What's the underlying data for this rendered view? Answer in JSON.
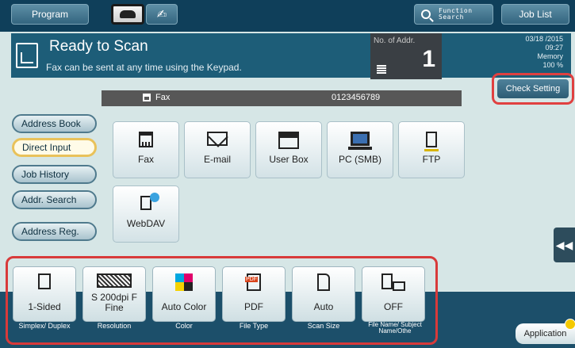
{
  "topbar": {
    "program": "Program",
    "function_search_1": "Function",
    "function_search_2": "Search",
    "job_list": "Job List"
  },
  "status": {
    "title": "Ready to Scan",
    "subtitle": "Fax can be sent at any time using the Keypad.",
    "addr_label": "No. of Addr.",
    "addr_count": "1",
    "date": "03/18 /2015",
    "time": "09:27",
    "memory_label": "Memory",
    "memory_value": "100 %"
  },
  "faxbar": {
    "label": "Fax",
    "number": "0123456789"
  },
  "check_setting": "Check Setting",
  "side_menu": [
    {
      "label": "Address Book",
      "active": false
    },
    {
      "label": "Direct Input",
      "active": true
    },
    {
      "label": "Job History",
      "active": false
    },
    {
      "label": "Addr. Search",
      "active": false
    },
    {
      "label": "Address Reg.",
      "active": false
    }
  ],
  "destinations": [
    {
      "label": "Fax",
      "icon": "fax-icon"
    },
    {
      "label": "E-mail",
      "icon": "mail-icon"
    },
    {
      "label": "User Box",
      "icon": "user-box-icon"
    },
    {
      "label": "PC (SMB)",
      "icon": "pc-icon"
    },
    {
      "label": "FTP",
      "icon": "ftp-icon"
    },
    {
      "label": "WebDAV",
      "icon": "webdav-icon"
    }
  ],
  "collapse_glyph": "◀◀",
  "settings": [
    {
      "value": "1-Sided",
      "caption": "Simplex/ Duplex",
      "icon": "simplex-icon"
    },
    {
      "value": "S 200dpi F Fine",
      "caption": "Resolution",
      "icon": "resolution-icon"
    },
    {
      "value": "Auto Color",
      "caption": "Color",
      "icon": "color-icon"
    },
    {
      "value": "PDF",
      "caption": "File Type",
      "icon": "pdf-icon"
    },
    {
      "value": "Auto",
      "caption": "Scan Size",
      "icon": "scan-size-icon"
    },
    {
      "value": "OFF",
      "caption": "File Name/ Subject Name/Othe",
      "icon": "file-name-icon"
    }
  ],
  "application": "Application",
  "colors": {
    "top_bar": "#0f3f5a",
    "status_bar": "#1d5d78",
    "highlight_frame": "#d83a3a",
    "active_menu_border": "#e9c25a"
  }
}
